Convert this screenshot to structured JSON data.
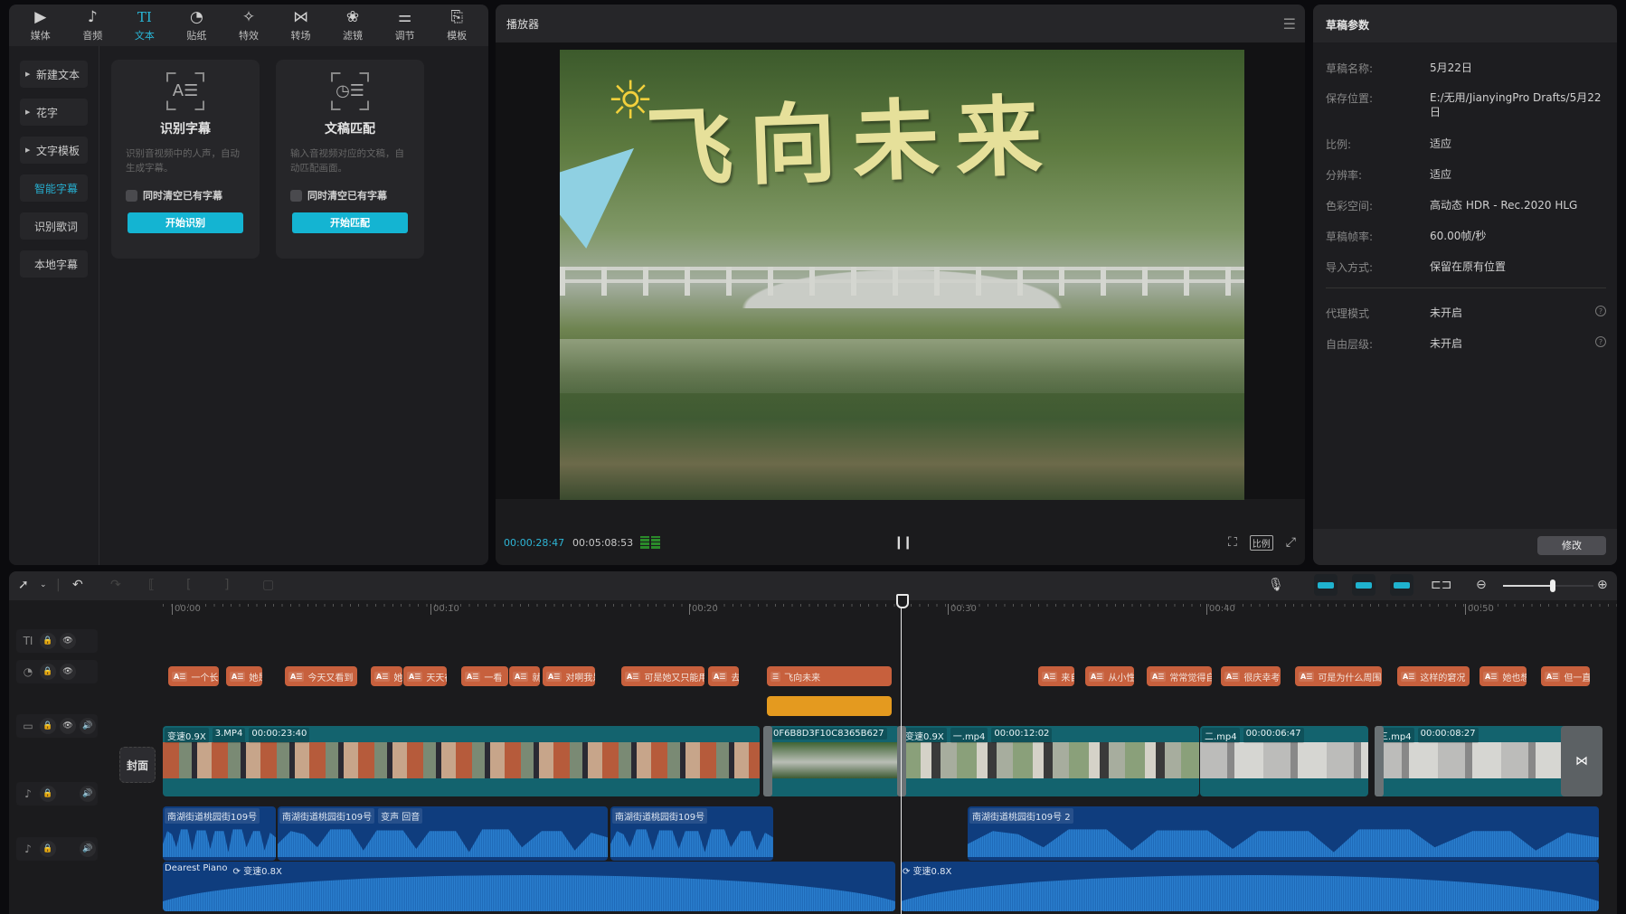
{
  "toolbar": {
    "tabs": [
      {
        "label": "媒体",
        "icon": "media-icon",
        "glyph": "▶"
      },
      {
        "label": "音频",
        "icon": "audio-icon",
        "glyph": "♪"
      },
      {
        "label": "文本",
        "icon": "text-icon",
        "glyph": "TI",
        "active": true
      },
      {
        "label": "贴纸",
        "icon": "sticker-icon",
        "glyph": "◔"
      },
      {
        "label": "特效",
        "icon": "effects-icon",
        "glyph": "✧"
      },
      {
        "label": "转场",
        "icon": "transition-icon",
        "glyph": "⋈"
      },
      {
        "label": "滤镜",
        "icon": "filter-icon",
        "glyph": "❀"
      },
      {
        "label": "调节",
        "icon": "adjust-icon",
        "glyph": "⚌"
      },
      {
        "label": "模板",
        "icon": "template-icon",
        "glyph": "⎘"
      }
    ]
  },
  "left_nav": {
    "items": [
      {
        "label": "新建文本",
        "arrow": true
      },
      {
        "label": "花字",
        "arrow": true
      },
      {
        "label": "文字模板",
        "arrow": true
      },
      {
        "label": "智能字幕",
        "active": true
      },
      {
        "label": "识别歌词"
      },
      {
        "label": "本地字幕"
      }
    ]
  },
  "cards": [
    {
      "title": "识别字幕",
      "glyph": "A☰",
      "desc": "识别音视频中的人声，自动生成字幕。",
      "checkbox": "同时清空已有字幕",
      "button": "开始识别"
    },
    {
      "title": "文稿匹配",
      "glyph": "◷☰",
      "desc": "输入音视频对应的文稿，自动匹配画面。",
      "checkbox": "同时清空已有字幕",
      "button": "开始匹配"
    }
  ],
  "player": {
    "title": "播放器",
    "overlay_title": "飞向未来",
    "current_time": "00:00:28:47",
    "total_time": "00:05:08:53",
    "ratio_label": "比例"
  },
  "draft": {
    "title": "草稿参数",
    "fields": [
      {
        "key": "草稿名称:",
        "value": "5月22日"
      },
      {
        "key": "保存位置:",
        "value": "E:/无用/JianyingPro Drafts/5月22日"
      },
      {
        "key": "比例:",
        "value": "适应"
      },
      {
        "key": "分辨率:",
        "value": "适应"
      },
      {
        "key": "色彩空间:",
        "value": "高动态 HDR - Rec.2020 HLG"
      },
      {
        "key": "草稿帧率:",
        "value": "60.00帧/秒"
      },
      {
        "key": "导入方式:",
        "value": "保留在原有位置"
      }
    ],
    "extra_fields": [
      {
        "key": "代理模式",
        "value": "未开启"
      },
      {
        "key": "自由层级:",
        "value": "未开启"
      }
    ],
    "modify_label": "修改"
  },
  "timeline": {
    "ruler": [
      "00:00",
      "00:10",
      "00:20",
      "00:30",
      "00:40",
      "00:50"
    ],
    "zoom_level": 0.55,
    "cover_label": "封面",
    "text_clips": [
      "一个长",
      "她是",
      "今天又看到",
      "她是",
      "天天在",
      "一看",
      "就",
      "对啊我是",
      "可是她又只能用",
      "去",
      "来自",
      "从小性",
      "常常觉得自",
      "很庆幸考",
      "可是为什么周围",
      "这样的窘况",
      "她也想",
      "但一直"
    ],
    "title_clip": "飞向未来",
    "video_clips": [
      {
        "speed": "变速0.9X",
        "name": "3.MP4",
        "duration": "00:00:23:40"
      },
      {
        "name": "0F6B8D3F10C8365B627"
      },
      {
        "speed": "变速0.9X",
        "name": "一.mp4",
        "duration": "00:00:12:02"
      },
      {
        "name": "二.mp4",
        "duration": "00:00:06:47"
      },
      {
        "name": "三.mp4",
        "duration": "00:00:08:27"
      }
    ],
    "audio_clips": [
      {
        "name": "南湖街道桃园街109号"
      },
      {
        "name": "南湖街道桃园街109号",
        "effect": "变声 回音"
      },
      {
        "name": "南湖街道桃园街109号"
      },
      {
        "name": "南湖街道桃园街109号 2"
      }
    ],
    "music_clips": [
      {
        "name": "Dearest Piano",
        "speed": "变速0.8X"
      },
      {
        "name": "",
        "speed": "变速0.8X"
      }
    ]
  }
}
